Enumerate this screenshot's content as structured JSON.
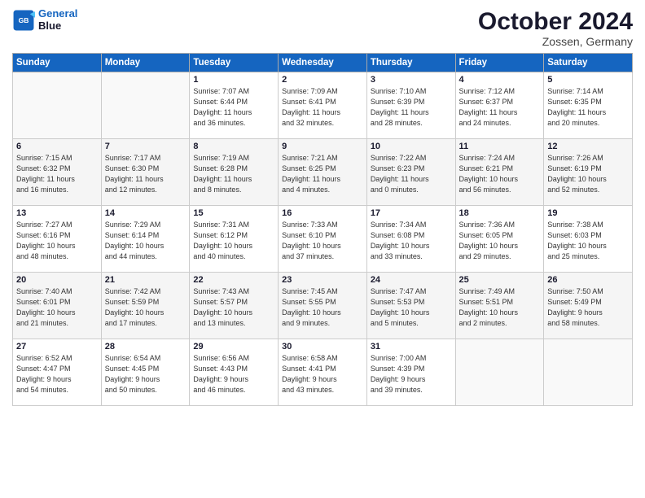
{
  "header": {
    "logo_line1": "General",
    "logo_line2": "Blue",
    "month": "October 2024",
    "location": "Zossen, Germany"
  },
  "weekdays": [
    "Sunday",
    "Monday",
    "Tuesday",
    "Wednesday",
    "Thursday",
    "Friday",
    "Saturday"
  ],
  "weeks": [
    [
      {
        "day": "",
        "info": ""
      },
      {
        "day": "",
        "info": ""
      },
      {
        "day": "1",
        "info": "Sunrise: 7:07 AM\nSunset: 6:44 PM\nDaylight: 11 hours\nand 36 minutes."
      },
      {
        "day": "2",
        "info": "Sunrise: 7:09 AM\nSunset: 6:41 PM\nDaylight: 11 hours\nand 32 minutes."
      },
      {
        "day": "3",
        "info": "Sunrise: 7:10 AM\nSunset: 6:39 PM\nDaylight: 11 hours\nand 28 minutes."
      },
      {
        "day": "4",
        "info": "Sunrise: 7:12 AM\nSunset: 6:37 PM\nDaylight: 11 hours\nand 24 minutes."
      },
      {
        "day": "5",
        "info": "Sunrise: 7:14 AM\nSunset: 6:35 PM\nDaylight: 11 hours\nand 20 minutes."
      }
    ],
    [
      {
        "day": "6",
        "info": "Sunrise: 7:15 AM\nSunset: 6:32 PM\nDaylight: 11 hours\nand 16 minutes."
      },
      {
        "day": "7",
        "info": "Sunrise: 7:17 AM\nSunset: 6:30 PM\nDaylight: 11 hours\nand 12 minutes."
      },
      {
        "day": "8",
        "info": "Sunrise: 7:19 AM\nSunset: 6:28 PM\nDaylight: 11 hours\nand 8 minutes."
      },
      {
        "day": "9",
        "info": "Sunrise: 7:21 AM\nSunset: 6:25 PM\nDaylight: 11 hours\nand 4 minutes."
      },
      {
        "day": "10",
        "info": "Sunrise: 7:22 AM\nSunset: 6:23 PM\nDaylight: 11 hours\nand 0 minutes."
      },
      {
        "day": "11",
        "info": "Sunrise: 7:24 AM\nSunset: 6:21 PM\nDaylight: 10 hours\nand 56 minutes."
      },
      {
        "day": "12",
        "info": "Sunrise: 7:26 AM\nSunset: 6:19 PM\nDaylight: 10 hours\nand 52 minutes."
      }
    ],
    [
      {
        "day": "13",
        "info": "Sunrise: 7:27 AM\nSunset: 6:16 PM\nDaylight: 10 hours\nand 48 minutes."
      },
      {
        "day": "14",
        "info": "Sunrise: 7:29 AM\nSunset: 6:14 PM\nDaylight: 10 hours\nand 44 minutes."
      },
      {
        "day": "15",
        "info": "Sunrise: 7:31 AM\nSunset: 6:12 PM\nDaylight: 10 hours\nand 40 minutes."
      },
      {
        "day": "16",
        "info": "Sunrise: 7:33 AM\nSunset: 6:10 PM\nDaylight: 10 hours\nand 37 minutes."
      },
      {
        "day": "17",
        "info": "Sunrise: 7:34 AM\nSunset: 6:08 PM\nDaylight: 10 hours\nand 33 minutes."
      },
      {
        "day": "18",
        "info": "Sunrise: 7:36 AM\nSunset: 6:05 PM\nDaylight: 10 hours\nand 29 minutes."
      },
      {
        "day": "19",
        "info": "Sunrise: 7:38 AM\nSunset: 6:03 PM\nDaylight: 10 hours\nand 25 minutes."
      }
    ],
    [
      {
        "day": "20",
        "info": "Sunrise: 7:40 AM\nSunset: 6:01 PM\nDaylight: 10 hours\nand 21 minutes."
      },
      {
        "day": "21",
        "info": "Sunrise: 7:42 AM\nSunset: 5:59 PM\nDaylight: 10 hours\nand 17 minutes."
      },
      {
        "day": "22",
        "info": "Sunrise: 7:43 AM\nSunset: 5:57 PM\nDaylight: 10 hours\nand 13 minutes."
      },
      {
        "day": "23",
        "info": "Sunrise: 7:45 AM\nSunset: 5:55 PM\nDaylight: 10 hours\nand 9 minutes."
      },
      {
        "day": "24",
        "info": "Sunrise: 7:47 AM\nSunset: 5:53 PM\nDaylight: 10 hours\nand 5 minutes."
      },
      {
        "day": "25",
        "info": "Sunrise: 7:49 AM\nSunset: 5:51 PM\nDaylight: 10 hours\nand 2 minutes."
      },
      {
        "day": "26",
        "info": "Sunrise: 7:50 AM\nSunset: 5:49 PM\nDaylight: 9 hours\nand 58 minutes."
      }
    ],
    [
      {
        "day": "27",
        "info": "Sunrise: 6:52 AM\nSunset: 4:47 PM\nDaylight: 9 hours\nand 54 minutes."
      },
      {
        "day": "28",
        "info": "Sunrise: 6:54 AM\nSunset: 4:45 PM\nDaylight: 9 hours\nand 50 minutes."
      },
      {
        "day": "29",
        "info": "Sunrise: 6:56 AM\nSunset: 4:43 PM\nDaylight: 9 hours\nand 46 minutes."
      },
      {
        "day": "30",
        "info": "Sunrise: 6:58 AM\nSunset: 4:41 PM\nDaylight: 9 hours\nand 43 minutes."
      },
      {
        "day": "31",
        "info": "Sunrise: 7:00 AM\nSunset: 4:39 PM\nDaylight: 9 hours\nand 39 minutes."
      },
      {
        "day": "",
        "info": ""
      },
      {
        "day": "",
        "info": ""
      }
    ]
  ]
}
